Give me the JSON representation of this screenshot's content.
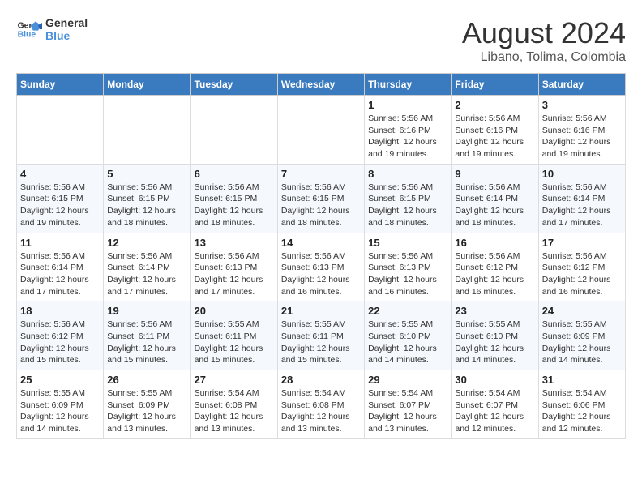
{
  "header": {
    "logo_line1": "General",
    "logo_line2": "Blue",
    "title": "August 2024",
    "subtitle": "Libano, Tolima, Colombia"
  },
  "weekdays": [
    "Sunday",
    "Monday",
    "Tuesday",
    "Wednesday",
    "Thursday",
    "Friday",
    "Saturday"
  ],
  "weeks": [
    [
      {
        "day": "",
        "info": ""
      },
      {
        "day": "",
        "info": ""
      },
      {
        "day": "",
        "info": ""
      },
      {
        "day": "",
        "info": ""
      },
      {
        "day": "1",
        "info": "Sunrise: 5:56 AM\nSunset: 6:16 PM\nDaylight: 12 hours\nand 19 minutes."
      },
      {
        "day": "2",
        "info": "Sunrise: 5:56 AM\nSunset: 6:16 PM\nDaylight: 12 hours\nand 19 minutes."
      },
      {
        "day": "3",
        "info": "Sunrise: 5:56 AM\nSunset: 6:16 PM\nDaylight: 12 hours\nand 19 minutes."
      }
    ],
    [
      {
        "day": "4",
        "info": "Sunrise: 5:56 AM\nSunset: 6:15 PM\nDaylight: 12 hours\nand 19 minutes."
      },
      {
        "day": "5",
        "info": "Sunrise: 5:56 AM\nSunset: 6:15 PM\nDaylight: 12 hours\nand 18 minutes."
      },
      {
        "day": "6",
        "info": "Sunrise: 5:56 AM\nSunset: 6:15 PM\nDaylight: 12 hours\nand 18 minutes."
      },
      {
        "day": "7",
        "info": "Sunrise: 5:56 AM\nSunset: 6:15 PM\nDaylight: 12 hours\nand 18 minutes."
      },
      {
        "day": "8",
        "info": "Sunrise: 5:56 AM\nSunset: 6:15 PM\nDaylight: 12 hours\nand 18 minutes."
      },
      {
        "day": "9",
        "info": "Sunrise: 5:56 AM\nSunset: 6:14 PM\nDaylight: 12 hours\nand 18 minutes."
      },
      {
        "day": "10",
        "info": "Sunrise: 5:56 AM\nSunset: 6:14 PM\nDaylight: 12 hours\nand 17 minutes."
      }
    ],
    [
      {
        "day": "11",
        "info": "Sunrise: 5:56 AM\nSunset: 6:14 PM\nDaylight: 12 hours\nand 17 minutes."
      },
      {
        "day": "12",
        "info": "Sunrise: 5:56 AM\nSunset: 6:14 PM\nDaylight: 12 hours\nand 17 minutes."
      },
      {
        "day": "13",
        "info": "Sunrise: 5:56 AM\nSunset: 6:13 PM\nDaylight: 12 hours\nand 17 minutes."
      },
      {
        "day": "14",
        "info": "Sunrise: 5:56 AM\nSunset: 6:13 PM\nDaylight: 12 hours\nand 16 minutes."
      },
      {
        "day": "15",
        "info": "Sunrise: 5:56 AM\nSunset: 6:13 PM\nDaylight: 12 hours\nand 16 minutes."
      },
      {
        "day": "16",
        "info": "Sunrise: 5:56 AM\nSunset: 6:12 PM\nDaylight: 12 hours\nand 16 minutes."
      },
      {
        "day": "17",
        "info": "Sunrise: 5:56 AM\nSunset: 6:12 PM\nDaylight: 12 hours\nand 16 minutes."
      }
    ],
    [
      {
        "day": "18",
        "info": "Sunrise: 5:56 AM\nSunset: 6:12 PM\nDaylight: 12 hours\nand 15 minutes."
      },
      {
        "day": "19",
        "info": "Sunrise: 5:56 AM\nSunset: 6:11 PM\nDaylight: 12 hours\nand 15 minutes."
      },
      {
        "day": "20",
        "info": "Sunrise: 5:55 AM\nSunset: 6:11 PM\nDaylight: 12 hours\nand 15 minutes."
      },
      {
        "day": "21",
        "info": "Sunrise: 5:55 AM\nSunset: 6:11 PM\nDaylight: 12 hours\nand 15 minutes."
      },
      {
        "day": "22",
        "info": "Sunrise: 5:55 AM\nSunset: 6:10 PM\nDaylight: 12 hours\nand 14 minutes."
      },
      {
        "day": "23",
        "info": "Sunrise: 5:55 AM\nSunset: 6:10 PM\nDaylight: 12 hours\nand 14 minutes."
      },
      {
        "day": "24",
        "info": "Sunrise: 5:55 AM\nSunset: 6:09 PM\nDaylight: 12 hours\nand 14 minutes."
      }
    ],
    [
      {
        "day": "25",
        "info": "Sunrise: 5:55 AM\nSunset: 6:09 PM\nDaylight: 12 hours\nand 14 minutes."
      },
      {
        "day": "26",
        "info": "Sunrise: 5:55 AM\nSunset: 6:09 PM\nDaylight: 12 hours\nand 13 minutes."
      },
      {
        "day": "27",
        "info": "Sunrise: 5:54 AM\nSunset: 6:08 PM\nDaylight: 12 hours\nand 13 minutes."
      },
      {
        "day": "28",
        "info": "Sunrise: 5:54 AM\nSunset: 6:08 PM\nDaylight: 12 hours\nand 13 minutes."
      },
      {
        "day": "29",
        "info": "Sunrise: 5:54 AM\nSunset: 6:07 PM\nDaylight: 12 hours\nand 13 minutes."
      },
      {
        "day": "30",
        "info": "Sunrise: 5:54 AM\nSunset: 6:07 PM\nDaylight: 12 hours\nand 12 minutes."
      },
      {
        "day": "31",
        "info": "Sunrise: 5:54 AM\nSunset: 6:06 PM\nDaylight: 12 hours\nand 12 minutes."
      }
    ]
  ]
}
